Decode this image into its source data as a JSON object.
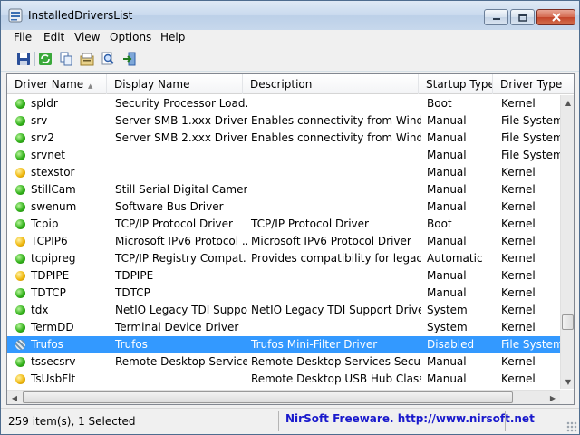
{
  "window": {
    "title": "InstalledDriversList"
  },
  "menu": [
    "File",
    "Edit",
    "View",
    "Options",
    "Help"
  ],
  "toolbar": {
    "icons": [
      "save-icon",
      "refresh-icon",
      "copy-icon",
      "properties-icon",
      "find-icon",
      "exit-icon"
    ]
  },
  "table": {
    "columns": [
      "Driver Name",
      "Display Name",
      "Description",
      "Startup Type",
      "Driver Type"
    ],
    "rows": [
      {
        "status": "green",
        "name": "spldr",
        "display": "Security Processor Load...",
        "desc": "",
        "start": "Boot",
        "type": "Kernel"
      },
      {
        "status": "green",
        "name": "srv",
        "display": "Server SMB 1.xxx Driver",
        "desc": "Enables connectivity from Wind...",
        "start": "Manual",
        "type": "File System"
      },
      {
        "status": "green",
        "name": "srv2",
        "display": "Server SMB 2.xxx Driver",
        "desc": "Enables connectivity from Wind...",
        "start": "Manual",
        "type": "File System"
      },
      {
        "status": "green",
        "name": "srvnet",
        "display": "",
        "desc": "",
        "start": "Manual",
        "type": "File System"
      },
      {
        "status": "yellow",
        "name": "stexstor",
        "display": "",
        "desc": "",
        "start": "Manual",
        "type": "Kernel"
      },
      {
        "status": "green",
        "name": "StillCam",
        "display": "Still Serial Digital Camer...",
        "desc": "",
        "start": "Manual",
        "type": "Kernel"
      },
      {
        "status": "green",
        "name": "swenum",
        "display": "Software Bus Driver",
        "desc": "",
        "start": "Manual",
        "type": "Kernel"
      },
      {
        "status": "green",
        "name": "Tcpip",
        "display": "TCP/IP Protocol Driver",
        "desc": "TCP/IP Protocol Driver",
        "start": "Boot",
        "type": "Kernel"
      },
      {
        "status": "yellow",
        "name": "TCPIP6",
        "display": "Microsoft IPv6 Protocol ...",
        "desc": "Microsoft IPv6 Protocol Driver",
        "start": "Manual",
        "type": "Kernel"
      },
      {
        "status": "green",
        "name": "tcpipreg",
        "display": "TCP/IP Registry Compat...",
        "desc": "Provides compatibility for legacy...",
        "start": "Automatic",
        "type": "Kernel"
      },
      {
        "status": "yellow",
        "name": "TDPIPE",
        "display": "TDPIPE",
        "desc": "",
        "start": "Manual",
        "type": "Kernel"
      },
      {
        "status": "green",
        "name": "TDTCP",
        "display": "TDTCP",
        "desc": "",
        "start": "Manual",
        "type": "Kernel"
      },
      {
        "status": "green",
        "name": "tdx",
        "display": "NetIO Legacy TDI Suppo...",
        "desc": "NetIO Legacy TDI Support Driver",
        "start": "System",
        "type": "Kernel"
      },
      {
        "status": "green",
        "name": "TermDD",
        "display": "Terminal Device Driver",
        "desc": "",
        "start": "System",
        "type": "Kernel"
      },
      {
        "status": "hatch",
        "name": "Trufos",
        "display": "Trufos",
        "desc": "Trufos Mini-Filter Driver",
        "start": "Disabled",
        "type": "File System",
        "selected": true
      },
      {
        "status": "green",
        "name": "tssecsrv",
        "display": "Remote Desktop Service...",
        "desc": "Remote Desktop Services Securit...",
        "start": "Manual",
        "type": "Kernel"
      },
      {
        "status": "yellow",
        "name": "TsUsbFlt",
        "display": "",
        "desc": "Remote Desktop USB Hub Class ...",
        "start": "Manual",
        "type": "Kernel"
      }
    ]
  },
  "status": {
    "count": "259 item(s), 1 Selected",
    "link": "NirSoft Freeware.  http://www.nirsoft.net"
  }
}
